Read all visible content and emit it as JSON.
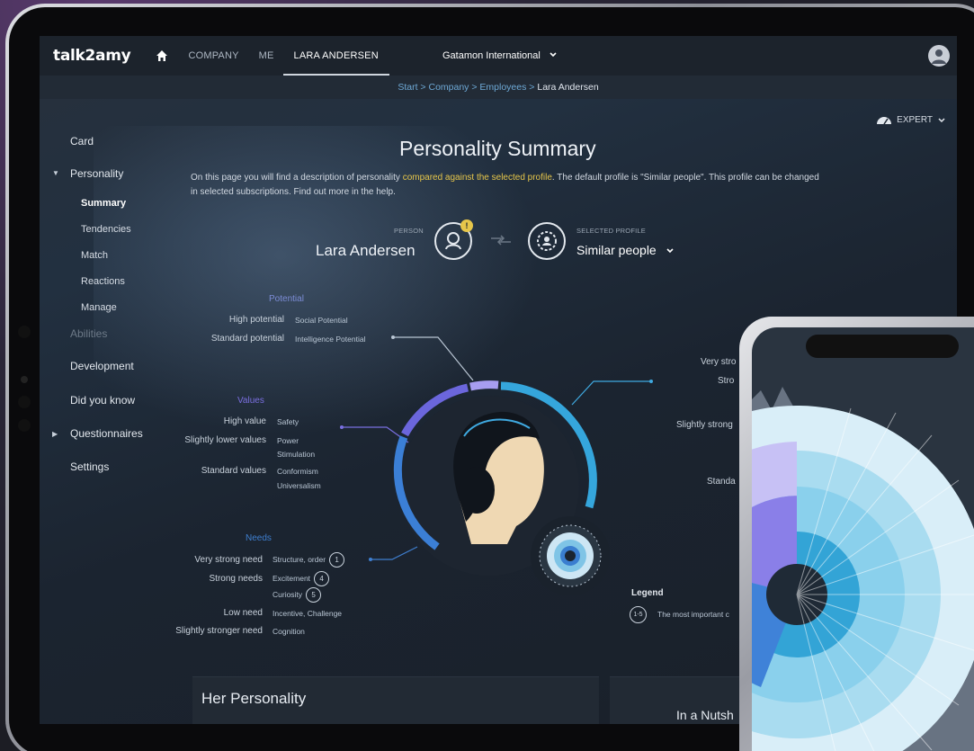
{
  "app": {
    "logo": "talk2amy"
  },
  "nav": {
    "tabs": [
      {
        "label": "COMPANY"
      },
      {
        "label": "ME"
      },
      {
        "label": "LARA ANDERSEN",
        "active": true
      }
    ],
    "organization": "Gatamon International"
  },
  "breadcrumb": {
    "items": [
      "Start",
      "Company",
      "Employees"
    ],
    "current": "Lara Andersen",
    "separator": ">"
  },
  "sidebar": {
    "items": [
      "Card",
      "Personality",
      "Summary",
      "Tendencies",
      "Match",
      "Reactions",
      "Manage",
      "Abilities",
      "Development",
      "Did you know",
      "Questionnaires",
      "Settings"
    ]
  },
  "mode": {
    "label": "EXPERT"
  },
  "page": {
    "title": "Personality Summary",
    "intro_start": "On this page you will find a description of personality ",
    "intro_highlight": "compared against the selected profile",
    "intro_end": ". The default profile is \"Similar people\". This profile can be changed in selected subscriptions. Find out more in the help."
  },
  "person": {
    "caption": "PERSON",
    "name": "Lara Andersen",
    "badge": "!"
  },
  "profile": {
    "caption": "SELECTED PROFILE",
    "value": "Similar people"
  },
  "potential": {
    "heading": "Potential",
    "rows": [
      {
        "label": "High potential",
        "value": "Social Potential"
      },
      {
        "label": "Standard potential",
        "value": "Intelligence Potential"
      }
    ]
  },
  "values": {
    "heading": "Values",
    "rows": [
      {
        "label": "High value",
        "values": [
          "Safety"
        ]
      },
      {
        "label": "Slightly lower values",
        "values": [
          "Power",
          "Stimulation"
        ]
      },
      {
        "label": "Standard values",
        "values": [
          "Conformism",
          "Universalism"
        ]
      }
    ]
  },
  "needs": {
    "heading": "Needs",
    "rows": [
      {
        "label": "Very strong need",
        "value": "Structure, order",
        "num": "1"
      },
      {
        "label": "Strong needs",
        "value": "Excitement",
        "num": "4"
      },
      {
        "label": "",
        "value": "Curiosity",
        "num": "5"
      },
      {
        "label": "Low need",
        "value": "Incentive, Challenge"
      },
      {
        "label": "Slightly stronger need",
        "value": "Cognition"
      }
    ]
  },
  "right_labels": [
    "Very stro",
    "Stro",
    "Slightly strong",
    "Standa"
  ],
  "legend": {
    "title": "Legend",
    "badge": "1-5",
    "text": "The most important c"
  },
  "panels": {
    "her_personality": "Her Personality",
    "nutshell": "In a Nutsh"
  },
  "colors": {
    "accent_blue": "#3fa9e0",
    "purple": "#7b6fe0",
    "highlight": "#e6c64a"
  }
}
